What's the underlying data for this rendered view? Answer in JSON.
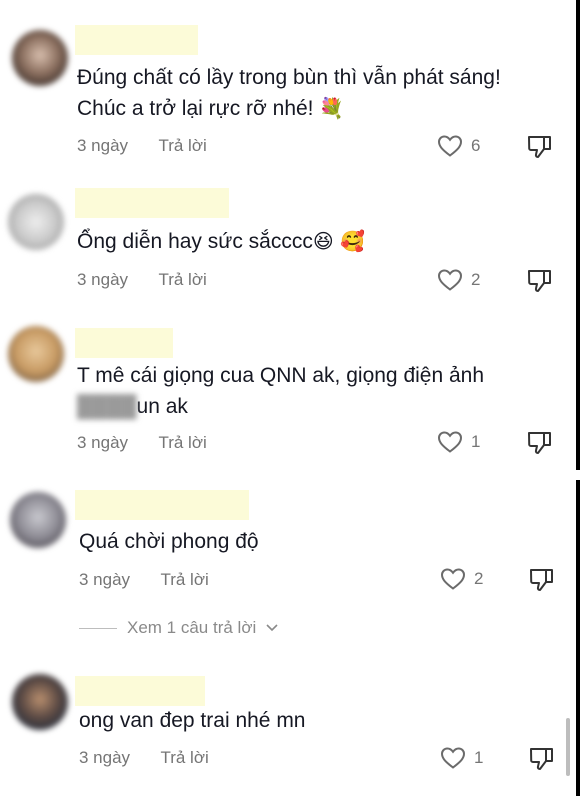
{
  "comments": [
    {
      "text_lines": [
        "Đúng chất có lầy trong bùn thì vẫn phát sáng!",
        "Chúc a trở lại rực rỡ nhé!"
      ],
      "emoji": "💐",
      "time": "3 ngày",
      "reply_label": "Trả lời",
      "likes": "6"
    },
    {
      "text_lines": [
        "Ổng diễn hay sức sắcccc"
      ],
      "emoji": "😆 🥰",
      "time": "3 ngày",
      "reply_label": "Trả lời",
      "likes": "2"
    },
    {
      "text_lines": [
        "T mê cái giọng cua QNN ak, giọng điện ảnh",
        "un ak"
      ],
      "time": "3 ngày",
      "reply_label": "Trả lời",
      "likes": "1"
    },
    {
      "text_lines": [
        "Quá chời phong độ"
      ],
      "time": "3 ngày",
      "reply_label": "Trả lời",
      "likes": "2",
      "view_replies": "Xem 1 câu trả lời"
    },
    {
      "text_lines": [
        "ong van đep trai nhé mn"
      ],
      "time": "3 ngày",
      "reply_label": "Trả lời",
      "likes": "1"
    }
  ],
  "colors": {
    "text": "#161823",
    "meta": "#757575",
    "name_redaction": "#fcfbd8"
  }
}
